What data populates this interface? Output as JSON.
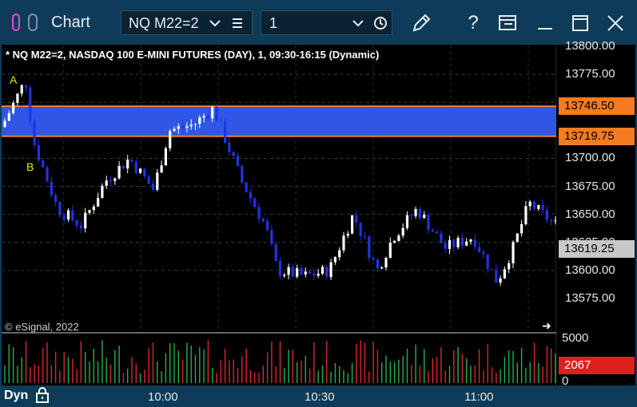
{
  "window": {
    "title": "Chart",
    "colors": {
      "titlebar": "#0e3b57",
      "accent": "#e94bd8"
    }
  },
  "toolbar": {
    "symbol_value": "NQ M22=2",
    "interval_value": "1",
    "icons": [
      "menu-lines-icon",
      "clock-icon",
      "pencil-icon",
      "help-icon",
      "window-layout-icon",
      "minimize-icon",
      "maximize-icon",
      "close-icon"
    ]
  },
  "chart": {
    "header": "* NQ M22=2, NASDAQ 100 E-MINI FUTURES (DAY), 1, 09:30-16:15 (Dynamic)",
    "marker_a": "A",
    "marker_b": "B",
    "copyright": "© eSignal, 2022",
    "price_labels": [
      "13800.00",
      "13775.00",
      "13746.50",
      "13719.75",
      "13700.00",
      "13675.00",
      "13650.00",
      "13625.00",
      "13619.25",
      "13600.00",
      "13575.00"
    ],
    "price_values": [
      13800,
      13775,
      13746.5,
      13719.75,
      13700,
      13675,
      13650,
      13625,
      13619.25,
      13600,
      13575
    ],
    "zone": {
      "upper": 13746.5,
      "lower": 13719.75,
      "color": "#2f5cf0",
      "line_color": "#f47b20"
    },
    "last_price": "13619.25",
    "volume_axis": [
      "5000",
      "0"
    ],
    "volume_current": "2067",
    "time_labels": [
      "10:00",
      "10:30",
      "11:00"
    ],
    "dyn_label": "Dyn",
    "colors": {
      "up": "#ffffff",
      "down": "#2232e6",
      "vol_up": "#22b14c",
      "vol_down": "#d9272e",
      "price_tag": "#f47b20",
      "last_tag": "#c8c8c8",
      "vol_tag": "#e01e1e"
    }
  }
}
